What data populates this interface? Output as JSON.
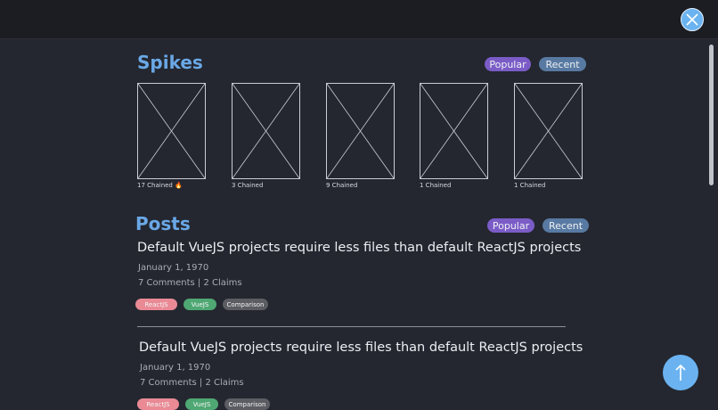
{
  "spikes": {
    "title": "Spikes",
    "filters": {
      "popular": "Popular",
      "recent": "Recent"
    },
    "items": [
      {
        "caption": "17 Chained",
        "hot": true
      },
      {
        "caption": "3 Chained",
        "hot": false
      },
      {
        "caption": "9 Chained",
        "hot": false
      },
      {
        "caption": "1 Chained",
        "hot": false
      },
      {
        "caption": "1 Chained",
        "hot": false
      }
    ]
  },
  "posts": {
    "title": "Posts",
    "filters": {
      "popular": "Popular",
      "recent": "Recent"
    },
    "items": [
      {
        "title": "Default VueJS projects require less files than default ReactJS projects",
        "date": "January 1, 1970",
        "meta": "7 Comments | 2 Claims",
        "tags": [
          "ReactJS",
          "VueJS",
          "Comparison"
        ]
      },
      {
        "title": "Default VueJS projects require less files than default ReactJS projects",
        "date": "January 1, 1970",
        "meta": "7 Comments | 2 Claims",
        "tags": [
          "ReactJS",
          "VueJS",
          "Comparison"
        ]
      }
    ]
  },
  "colors": {
    "background": "#242730",
    "accent": "#6aa8e6",
    "popular": "#7b5cc7",
    "recent": "#587aa2",
    "tag_react": "#e98a95",
    "tag_vue": "#4fa873",
    "tag_comparison": "#5b5d62"
  },
  "icons": {
    "close": "close-icon",
    "scroll_top": "arrow-up-icon",
    "hot": "flame-icon",
    "placeholder": "image-placeholder-icon"
  }
}
